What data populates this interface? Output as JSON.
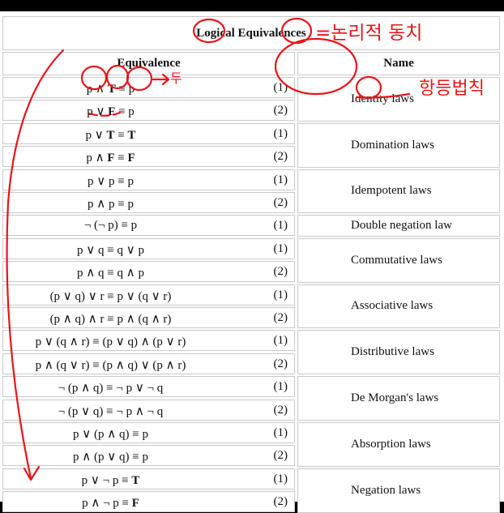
{
  "table": {
    "title": "Logical Equivalences",
    "col_equivalence": "Equivalence",
    "col_name": "Name",
    "rows": [
      {
        "eq": "p ∧ T ≡ p",
        "num": "(1)"
      },
      {
        "eq": "p ∨ F ≡ p",
        "num": "(2)"
      },
      {
        "eq": "p ∨ T ≡ T",
        "num": "(1)"
      },
      {
        "eq": "p ∧ F ≡ F",
        "num": "(2)"
      },
      {
        "eq": "p ∨ p ≡ p",
        "num": "(1)"
      },
      {
        "eq": "p ∧ p ≡ p",
        "num": "(2)"
      },
      {
        "eq": "¬ (¬ p) ≡ p",
        "num": "(1)"
      },
      {
        "eq": "p ∨ q ≡ q ∨ p",
        "num": "(1)"
      },
      {
        "eq": "p ∧ q ≡ q ∧ p",
        "num": "(2)"
      },
      {
        "eq": "(p ∨ q) ∨ r ≡ p ∨ (q ∨ r)",
        "num": "(1)"
      },
      {
        "eq": "(p ∧ q) ∧ r ≡ p ∧ (q ∧ r)",
        "num": "(2)"
      },
      {
        "eq": "p ∨ (q ∧ r) ≡ (p ∨ q) ∧ (p ∨ r)",
        "num": "(1)"
      },
      {
        "eq": "p ∧ (q ∨ r) ≡ (p ∧ q) ∨ (p ∧ r)",
        "num": "(2)"
      },
      {
        "eq": "¬ (p ∧ q) ≡ ¬ p ∨ ¬ q",
        "num": "(1)"
      },
      {
        "eq": "¬ (p ∨ q) ≡ ¬ p ∧ ¬ q",
        "num": "(2)"
      },
      {
        "eq": "p ∨ (p ∧ q) ≡ p",
        "num": "(1)"
      },
      {
        "eq": "p ∧ (p ∨ q) ≡ p",
        "num": "(2)"
      },
      {
        "eq": "p ∨ ¬ p ≡ T",
        "num": "(1)"
      },
      {
        "eq": "p ∧ ¬ p ≡ F",
        "num": "(2)"
      }
    ],
    "names": [
      "Identity laws",
      "Domination laws",
      "Idempotent laws",
      "Double negation law",
      "Commutative laws",
      "Associative laws",
      "Distributive laws",
      "De Morgan's laws",
      "Absorption laws",
      "Negation laws"
    ]
  },
  "annotations": {
    "handwritten_title_note": "=논리적 동치",
    "handwritten_identity_note": "항등법칙",
    "handwritten_arrow_note": "두",
    "ink_color": "#e8141b"
  }
}
